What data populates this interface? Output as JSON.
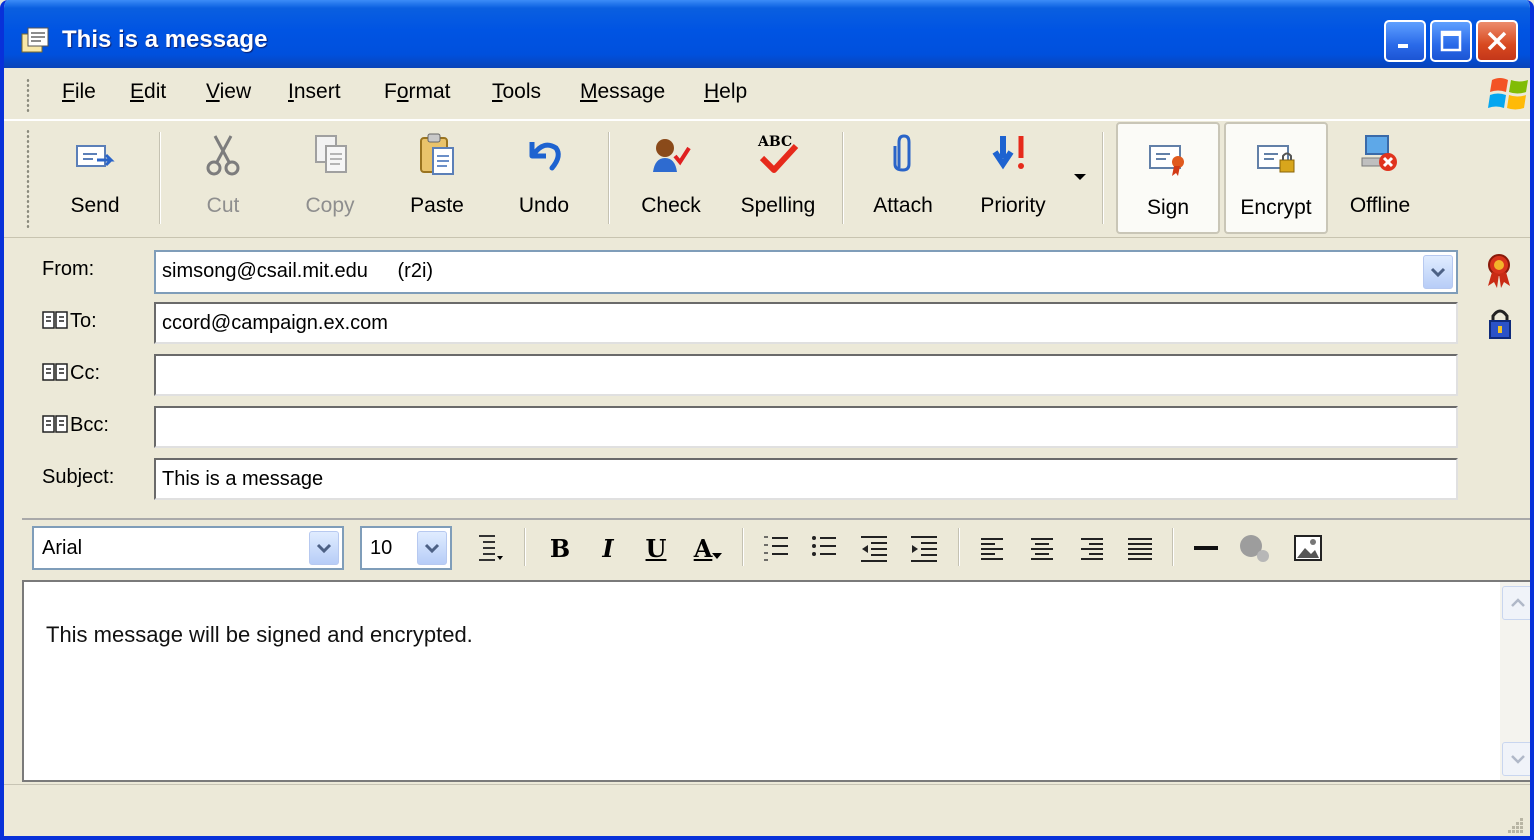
{
  "window": {
    "title": "This is a message",
    "controls": [
      "minimize",
      "maximize",
      "close"
    ]
  },
  "menu": {
    "items": [
      {
        "label": "File",
        "mnemonic": "F"
      },
      {
        "label": "Edit",
        "mnemonic": "E"
      },
      {
        "label": "View",
        "mnemonic": "V"
      },
      {
        "label": "Insert",
        "mnemonic": "I"
      },
      {
        "label": "Format",
        "mnemonic": "o"
      },
      {
        "label": "Tools",
        "mnemonic": "T"
      },
      {
        "label": "Message",
        "mnemonic": "M"
      },
      {
        "label": "Help",
        "mnemonic": "H"
      }
    ]
  },
  "toolbar": {
    "buttons": [
      {
        "label": "Send",
        "icon": "send-icon",
        "enabled": true
      },
      {
        "label": "Cut",
        "icon": "scissors-icon",
        "enabled": false
      },
      {
        "label": "Copy",
        "icon": "copy-icon",
        "enabled": false
      },
      {
        "label": "Paste",
        "icon": "paste-icon",
        "enabled": true
      },
      {
        "label": "Undo",
        "icon": "undo-icon",
        "enabled": true
      },
      {
        "label": "Check",
        "icon": "check-names-icon",
        "enabled": true
      },
      {
        "label": "Spelling",
        "icon": "spelling-icon",
        "icon_text": "ABC",
        "enabled": true
      },
      {
        "label": "Attach",
        "icon": "paperclip-icon",
        "enabled": true
      },
      {
        "label": "Priority",
        "icon": "priority-icon",
        "enabled": true
      },
      {
        "label": "Sign",
        "icon": "sign-icon",
        "enabled": true,
        "pressed": true
      },
      {
        "label": "Encrypt",
        "icon": "encrypt-icon",
        "enabled": true,
        "pressed": true
      },
      {
        "label": "Offline",
        "icon": "offline-icon",
        "enabled": true
      }
    ]
  },
  "header": {
    "from_label": "From:",
    "from_account": "simsong@csail.mit.edu",
    "from_account_tag": "(r2i)",
    "to_label": "To:",
    "to_value": "ccord@campaign.ex.com",
    "cc_label": "Cc:",
    "cc_value": "",
    "bcc_label": "Bcc:",
    "bcc_value": "",
    "subject_label": "Subject:",
    "subject_value": "This is a message",
    "side_icons": [
      "certificate-ribbon-icon",
      "padlock-icon"
    ]
  },
  "format_bar": {
    "font": "Arial",
    "size": "10",
    "bold": "B",
    "italic": "I",
    "underline": "U",
    "font_color": "A"
  },
  "body": {
    "text": "This message will be signed and encrypted."
  },
  "colors": {
    "title_bar": "#0054e3",
    "chrome": "#ece9d8",
    "field_border": "#7f9db9",
    "close_button": "#d8491f"
  }
}
